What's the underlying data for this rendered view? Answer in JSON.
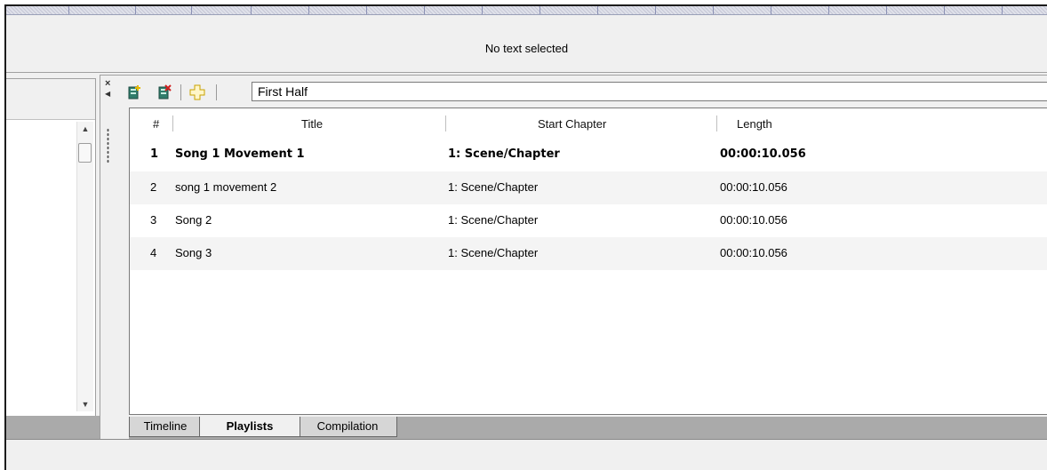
{
  "status": {
    "text": "No text selected"
  },
  "playlist": {
    "current": "First Half",
    "toolbar": {
      "icons": [
        "add-playlist-icon",
        "delete-playlist-icon",
        "add-item-icon"
      ]
    }
  },
  "table": {
    "headers": {
      "num": "#",
      "title": "Title",
      "start": "Start Chapter",
      "length": "Length"
    },
    "rows": [
      {
        "num": "1",
        "title": "Song 1 Movement 1",
        "start": "1: Scene/Chapter",
        "length": "00:00:10.056",
        "selected": true
      },
      {
        "num": "2",
        "title": "song 1 movement 2",
        "start": "1: Scene/Chapter",
        "length": "00:00:10.056"
      },
      {
        "num": "3",
        "title": "Song 2",
        "start": "1: Scene/Chapter",
        "length": "00:00:10.056"
      },
      {
        "num": "4",
        "title": "Song 3",
        "start": "1: Scene/Chapter",
        "length": "00:00:10.056"
      }
    ]
  },
  "tabs": {
    "timeline": "Timeline",
    "playlists": "Playlists",
    "compilation": "Compilation",
    "active": "Playlists"
  },
  "colors": {
    "tab_strip": "#aaaaaa",
    "ruler": "#dfe1ea",
    "row_alt": "#f4f4f4"
  }
}
